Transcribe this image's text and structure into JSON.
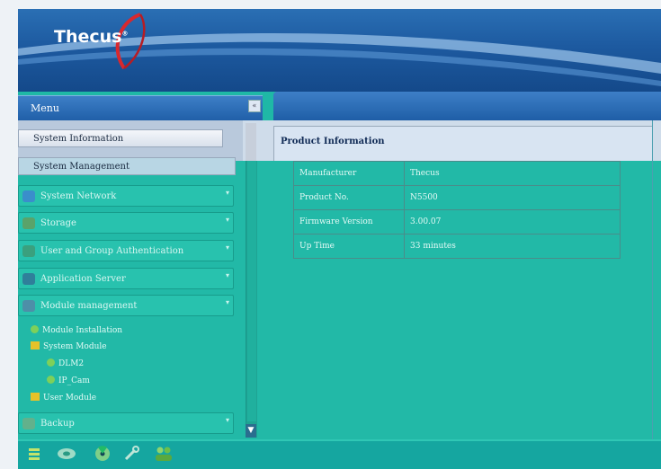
{
  "brand": {
    "logo_text": "Thecus",
    "trademark": "®"
  },
  "menu": {
    "title": "Menu",
    "close_glyph": "«",
    "items": [
      {
        "label": "System Information"
      },
      {
        "label": "System Management"
      },
      {
        "label": "System Network"
      },
      {
        "label": "Storage"
      },
      {
        "label": "User and Group Authentication"
      },
      {
        "label": "Application Server"
      },
      {
        "label": "Module management"
      },
      {
        "label": "Backup"
      }
    ],
    "tree": [
      {
        "label": "Module Installation"
      },
      {
        "label": "System Module"
      },
      {
        "label": "DLM2"
      },
      {
        "label": "IP_Cam"
      },
      {
        "label": "User Module"
      }
    ]
  },
  "content": {
    "section_title": "Product Information",
    "rows": [
      {
        "key": "Manufacturer",
        "value": "Thecus"
      },
      {
        "key": "Product No.",
        "value": "N5500"
      },
      {
        "key": "Firmware Version",
        "value": "3.00.07"
      },
      {
        "key": "Up Time",
        "value": "33 minutes"
      }
    ]
  },
  "toolbar": {
    "icons": [
      "list-icon",
      "disk-icon",
      "radiation-icon",
      "wrench-icon",
      "users-icon"
    ]
  },
  "colors": {
    "overlay_teal": "#22b9a7",
    "banner_blue": "#1d5aa0"
  }
}
